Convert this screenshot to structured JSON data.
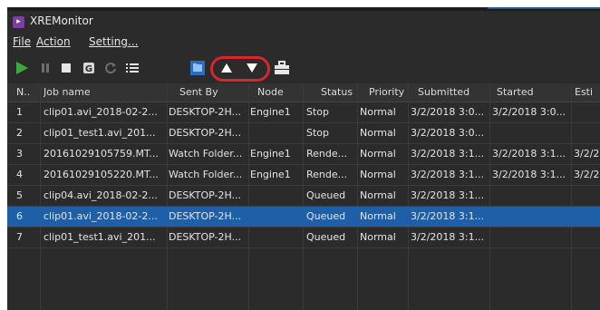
{
  "window": {
    "title": "XREMonitor",
    "icon": "app-icon"
  },
  "menu": {
    "file": "File",
    "action": "Action",
    "setting": "Setting..."
  },
  "toolbar": {
    "icons": [
      "play-icon",
      "pause-icon",
      "stop-icon",
      "delete-job-icon",
      "refresh-icon",
      "list-icon",
      "watch-folder-icon",
      "move-up-icon",
      "move-down-icon",
      "toolbox-icon"
    ],
    "highlight_color": "#d7262e",
    "play_color": "#3ea83e"
  },
  "table": {
    "columns": [
      "N..",
      "Job name",
      "Sent By",
      "Node",
      "Status",
      "Priority",
      "Submitted",
      "Started",
      "Esti"
    ],
    "rows": [
      [
        "1",
        "clip01.avi_2018-02-2...",
        "DESKTOP-2H...",
        "Engine1",
        "Stop",
        "Normal",
        "3/2/2018 3:0...",
        "3/2/2018 3:0...",
        ""
      ],
      [
        "2",
        "clip01_test1.avi_201...",
        "DESKTOP-2H...",
        "",
        "Stop",
        "Normal",
        "3/2/2018 3:0...",
        "",
        ""
      ],
      [
        "3",
        "20161029105759.MT...",
        "Watch Folder...",
        "Engine1",
        "Rende...",
        "Normal",
        "3/2/2018 3:1...",
        "3/2/2018 3:1...",
        "3/2/2"
      ],
      [
        "4",
        "20161029105220.MT...",
        "Watch Folder...",
        "Engine1",
        "Rende...",
        "Normal",
        "3/2/2018 3:1...",
        "3/2/2018 3:1...",
        "3/2/2"
      ],
      [
        "5",
        "clip04.avi_2018-02-2...",
        "DESKTOP-2H...",
        "",
        "Queued",
        "Normal",
        "3/2/2018 3:1...",
        "",
        ""
      ],
      [
        "6",
        "clip01.avi_2018-02-2...",
        "DESKTOP-2H...",
        "",
        "Queued",
        "Normal",
        "3/2/2018 3:1...",
        "",
        ""
      ],
      [
        "7",
        "clip01_test1.avi_201...",
        "DESKTOP-2H...",
        "",
        "Queued",
        "Normal",
        "3/2/2018 3:1...",
        "",
        ""
      ]
    ],
    "selected_row": 6,
    "selection_color": "#1f5fa8"
  }
}
